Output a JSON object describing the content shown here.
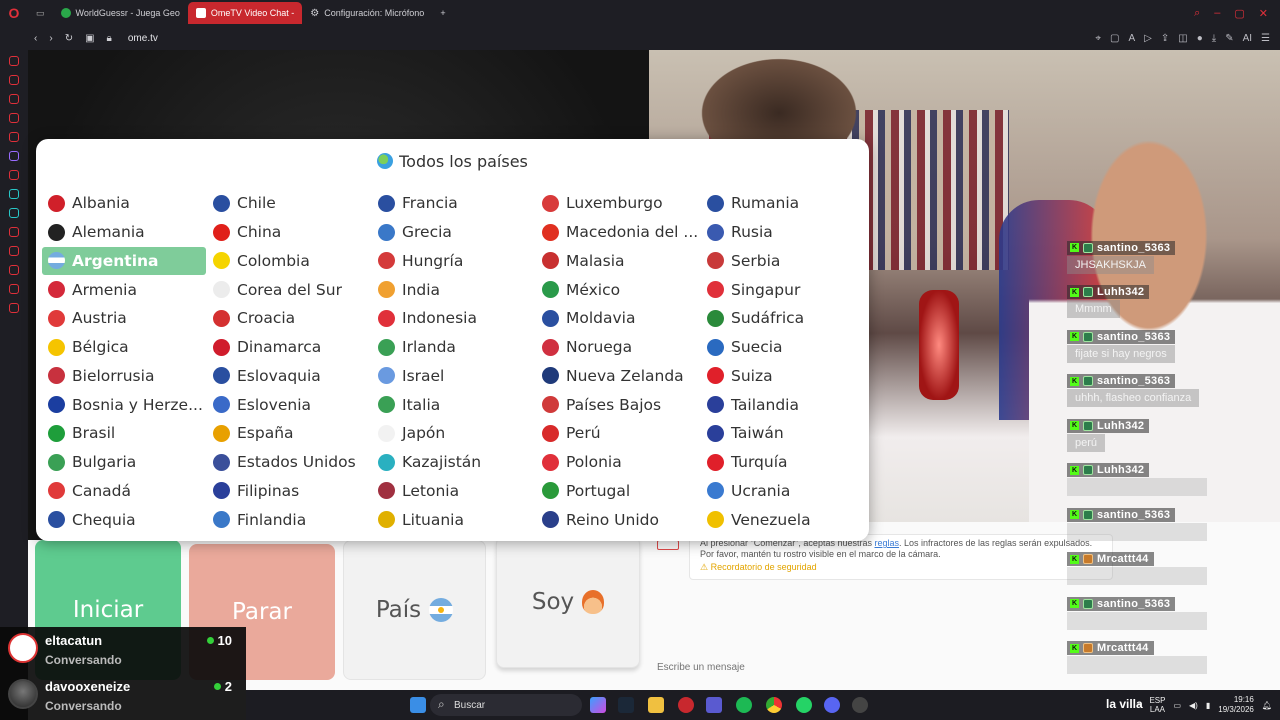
{
  "browser": {
    "tabs": [
      {
        "label": "WorldGuessr - Juega Geo",
        "color": "#2aa84a",
        "active": false
      },
      {
        "label": "OmeTV Video Chat -",
        "color": "#ffffff",
        "active": true
      },
      {
        "label": "Configuración: Micrófono",
        "color": "#bbbbbb",
        "active": false
      }
    ],
    "url": "ome.tv",
    "ai_label": "AI"
  },
  "dropdown": {
    "title": "Todos los países",
    "selected": "Argentina",
    "columns": [
      [
        {
          "name": "Albania",
          "flag": "#d0202a"
        },
        {
          "name": "Alemania",
          "flag": "#222222"
        },
        {
          "name": "Argentina",
          "flag": "#74acdf"
        },
        {
          "name": "Armenia",
          "flag": "#d4293a"
        },
        {
          "name": "Austria",
          "flag": "#e03a3a"
        },
        {
          "name": "Bélgica",
          "flag": "#f5c400"
        },
        {
          "name": "Bielorrusia",
          "flag": "#c8313e"
        },
        {
          "name": "Bosnia y Herze...",
          "flag": "#1b3ea0"
        },
        {
          "name": "Brasil",
          "flag": "#1e9e3b"
        },
        {
          "name": "Bulgaria",
          "flag": "#3aa055"
        },
        {
          "name": "Canadá",
          "flag": "#e03a3a"
        },
        {
          "name": "Chequia",
          "flag": "#2a4fa0"
        }
      ],
      [
        {
          "name": "Chile",
          "flag": "#2a4fa0"
        },
        {
          "name": "China",
          "flag": "#e0201a"
        },
        {
          "name": "Colombia",
          "flag": "#f5d400"
        },
        {
          "name": "Corea del Sur",
          "flag": "#ececec"
        },
        {
          "name": "Croacia",
          "flag": "#d43030"
        },
        {
          "name": "Dinamarca",
          "flag": "#d01c2c"
        },
        {
          "name": "Eslovaquia",
          "flag": "#2a4fa0"
        },
        {
          "name": "Eslovenia",
          "flag": "#3a6ac8"
        },
        {
          "name": "España",
          "flag": "#e8a000"
        },
        {
          "name": "Estados Unidos",
          "flag": "#3a4f9a"
        },
        {
          "name": "Filipinas",
          "flag": "#2a3f9a"
        },
        {
          "name": "Finlandia",
          "flag": "#3a78c8"
        }
      ],
      [
        {
          "name": "Francia",
          "flag": "#2a4fa0"
        },
        {
          "name": "Grecia",
          "flag": "#3a78c8"
        },
        {
          "name": "Hungría",
          "flag": "#d43a3a"
        },
        {
          "name": "India",
          "flag": "#f0a030"
        },
        {
          "name": "Indonesia",
          "flag": "#e0303a"
        },
        {
          "name": "Irlanda",
          "flag": "#3aa055"
        },
        {
          "name": "Israel",
          "flag": "#6a9ae0"
        },
        {
          "name": "Italia",
          "flag": "#3aa055"
        },
        {
          "name": "Japón",
          "flag": "#f2f2f2"
        },
        {
          "name": "Kazajistán",
          "flag": "#2ab0c0"
        },
        {
          "name": "Letonia",
          "flag": "#a03040"
        },
        {
          "name": "Lituania",
          "flag": "#e0b000"
        }
      ],
      [
        {
          "name": "Luxemburgo",
          "flag": "#d83a3a"
        },
        {
          "name": "Macedonia del ...",
          "flag": "#e03020"
        },
        {
          "name": "Malasia",
          "flag": "#c83030"
        },
        {
          "name": "México",
          "flag": "#2a9a4a"
        },
        {
          "name": "Moldavia",
          "flag": "#2a4fa0"
        },
        {
          "name": "Noruega",
          "flag": "#d03040"
        },
        {
          "name": "Nueva Zelanda",
          "flag": "#1f3a7a"
        },
        {
          "name": "Países Bajos",
          "flag": "#d03a3a"
        },
        {
          "name": "Perú",
          "flag": "#d82a2a"
        },
        {
          "name": "Polonia",
          "flag": "#e0303a"
        },
        {
          "name": "Portugal",
          "flag": "#2a9a3a"
        },
        {
          "name": "Reino Unido",
          "flag": "#2a3f8a"
        }
      ],
      [
        {
          "name": "Rumania",
          "flag": "#2a4fa0"
        },
        {
          "name": "Rusia",
          "flag": "#3a5ab0"
        },
        {
          "name": "Serbia",
          "flag": "#c83a3a"
        },
        {
          "name": "Singapur",
          "flag": "#e0303a"
        },
        {
          "name": "Sudáfrica",
          "flag": "#2a8a3a"
        },
        {
          "name": "Suecia",
          "flag": "#2a6ac0"
        },
        {
          "name": "Suiza",
          "flag": "#e0202a"
        },
        {
          "name": "Tailandia",
          "flag": "#2a3f9a"
        },
        {
          "name": "Taiwán",
          "flag": "#2a3f9a"
        },
        {
          "name": "Turquía",
          "flag": "#e0202a"
        },
        {
          "name": "Ucrania",
          "flag": "#3a7ad0"
        },
        {
          "name": "Venezuela",
          "flag": "#f0c000"
        }
      ]
    ]
  },
  "buttons": {
    "start": "Iniciar",
    "stop": "Parar",
    "country": "País",
    "me": "Soy"
  },
  "notice": {
    "text_before": "Al presionar \"Comenzar\", aceptas nuestras ",
    "link": "reglas",
    "text_after": ". Los infractores de las reglas serán expulsados. Por favor, mantén tu rostro visible en el marco de la cámara.",
    "warning": "Recordatorio de seguridad",
    "input_placeholder": "Escribe un mensaje"
  },
  "chat": [
    {
      "user": "santino_5363",
      "message": "JHSAKHSKJA",
      "avatar": "green"
    },
    {
      "user": "Luhh342",
      "message": "Mmmm",
      "avatar": "green"
    },
    {
      "user": "santino_5363",
      "message": "fijate si hay negros",
      "avatar": "green"
    },
    {
      "user": "santino_5363",
      "message": "uhhh, flasheo confianza",
      "avatar": "green"
    },
    {
      "user": "Luhh342",
      "message": "perú",
      "avatar": "green"
    },
    {
      "user": "Luhh342",
      "message": "",
      "avatar": "green"
    },
    {
      "user": "santino_5363",
      "message": "",
      "avatar": "green"
    },
    {
      "user": "Mrcattt44",
      "message": "",
      "avatar": "orange"
    },
    {
      "user": "santino_5363",
      "message": "",
      "avatar": "green"
    },
    {
      "user": "Mrcattt44",
      "message": "",
      "avatar": "orange"
    }
  ],
  "viewers": [
    {
      "name": "eltacatun",
      "status": "Conversando",
      "count": "10"
    },
    {
      "name": "davooxeneize",
      "status": "Conversando",
      "count": "2"
    }
  ],
  "taskbar": {
    "search": "Buscar",
    "lang_top": "ESP",
    "lang_bottom": "LAA",
    "time": "19:16",
    "date": "19/3/2026"
  },
  "overlay_label": "la villa"
}
